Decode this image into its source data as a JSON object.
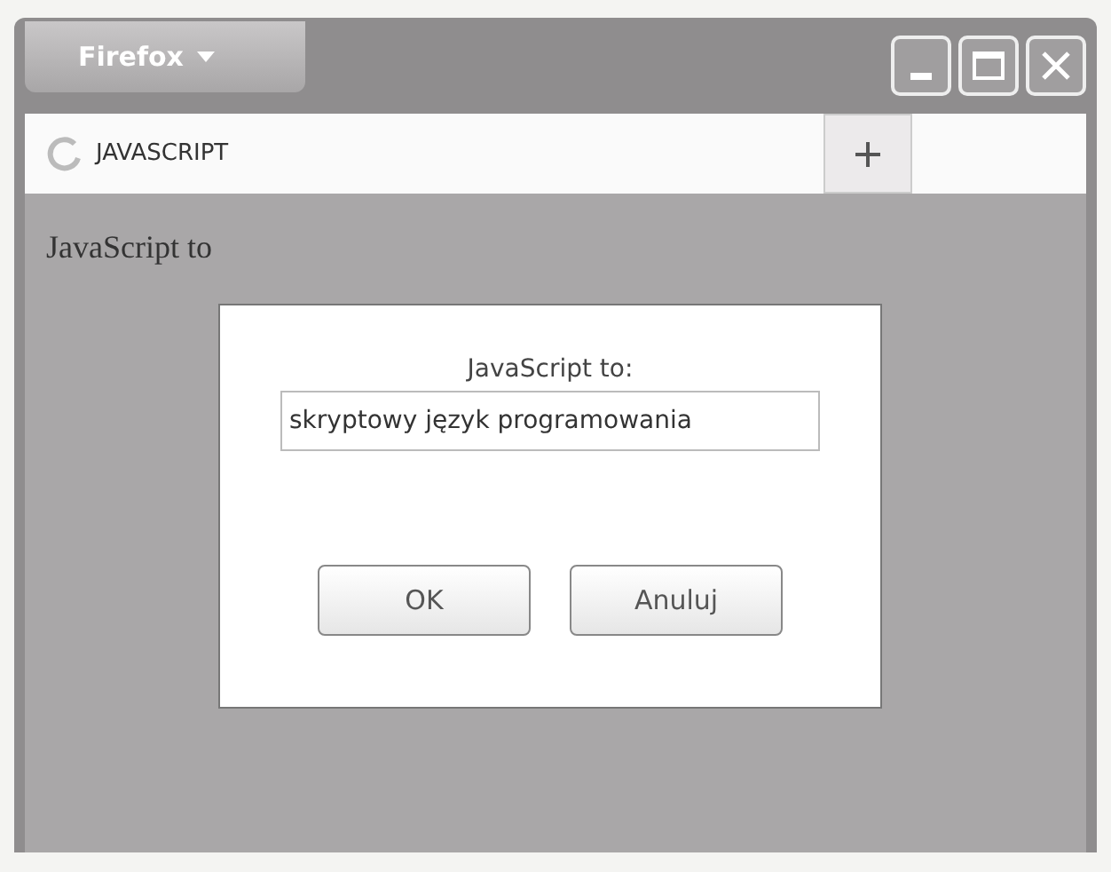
{
  "window": {
    "menu_button": "Firefox"
  },
  "tabs": [
    {
      "label": "JAVASCRIPT",
      "selected": true,
      "loading": true
    }
  ],
  "page": {
    "heading": "JavaScript to"
  },
  "dialog": {
    "prompt": "JavaScript to:",
    "value": "skryptowy język programowania",
    "buttons": [
      "OK",
      "Anuluj"
    ]
  }
}
